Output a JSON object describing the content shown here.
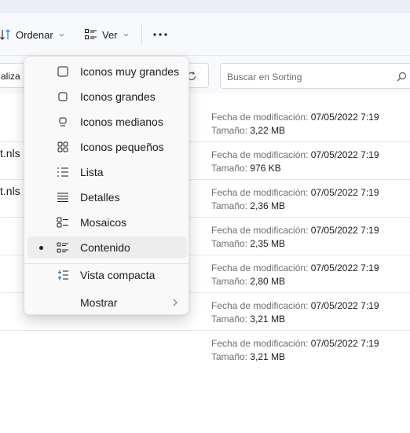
{
  "toolbar": {
    "sort_label": "Ordenar",
    "view_label": "Ver",
    "more_label": "···"
  },
  "address": {
    "partial_text": "aliza"
  },
  "search": {
    "placeholder": "Buscar en Sorting"
  },
  "files": [
    {
      "name": "",
      "date_label": "Fecha de modificación:",
      "date": "07/05/2022 7:19",
      "size_label": "Tamaño:",
      "size": "3,22 MB"
    },
    {
      "name": "t.nls",
      "date_label": "Fecha de modificación:",
      "date": "07/05/2022 7:19",
      "size_label": "Tamaño:",
      "size": "976 KB"
    },
    {
      "name": "t.nls",
      "date_label": "Fecha de modificación:",
      "date": "07/05/2022 7:19",
      "size_label": "Tamaño:",
      "size": "2,36 MB"
    },
    {
      "name": "",
      "date_label": "Fecha de modificación:",
      "date": "07/05/2022 7:19",
      "size_label": "Tamaño:",
      "size": "2,35 MB"
    },
    {
      "name": "",
      "date_label": "Fecha de modificación:",
      "date": "07/05/2022 7:19",
      "size_label": "Tamaño:",
      "size": "2,80 MB"
    },
    {
      "name": "",
      "date_label": "Fecha de modificación:",
      "date": "07/05/2022 7:19",
      "size_label": "Tamaño:",
      "size": "3,21 MB"
    },
    {
      "name": "",
      "date_label": "Fecha de modificación:",
      "date": "07/05/2022 7:19",
      "size_label": "Tamaño:",
      "size": "3,21 MB"
    }
  ],
  "view_menu": {
    "items": [
      {
        "label": "Iconos muy grandes",
        "icon": "extra-large-icons-icon"
      },
      {
        "label": "Iconos grandes",
        "icon": "large-icons-icon"
      },
      {
        "label": "Iconos medianos",
        "icon": "medium-icons-icon"
      },
      {
        "label": "Iconos pequeños",
        "icon": "small-icons-icon"
      },
      {
        "label": "Lista",
        "icon": "list-icon"
      },
      {
        "label": "Detalles",
        "icon": "details-icon"
      },
      {
        "label": "Mosaicos",
        "icon": "tiles-icon"
      },
      {
        "label": "Contenido",
        "icon": "content-icon",
        "selected": true
      },
      {
        "label": "Vista compacta",
        "icon": "compact-view-icon"
      },
      {
        "label": "Mostrar",
        "icon": "",
        "submenu": true
      }
    ]
  }
}
